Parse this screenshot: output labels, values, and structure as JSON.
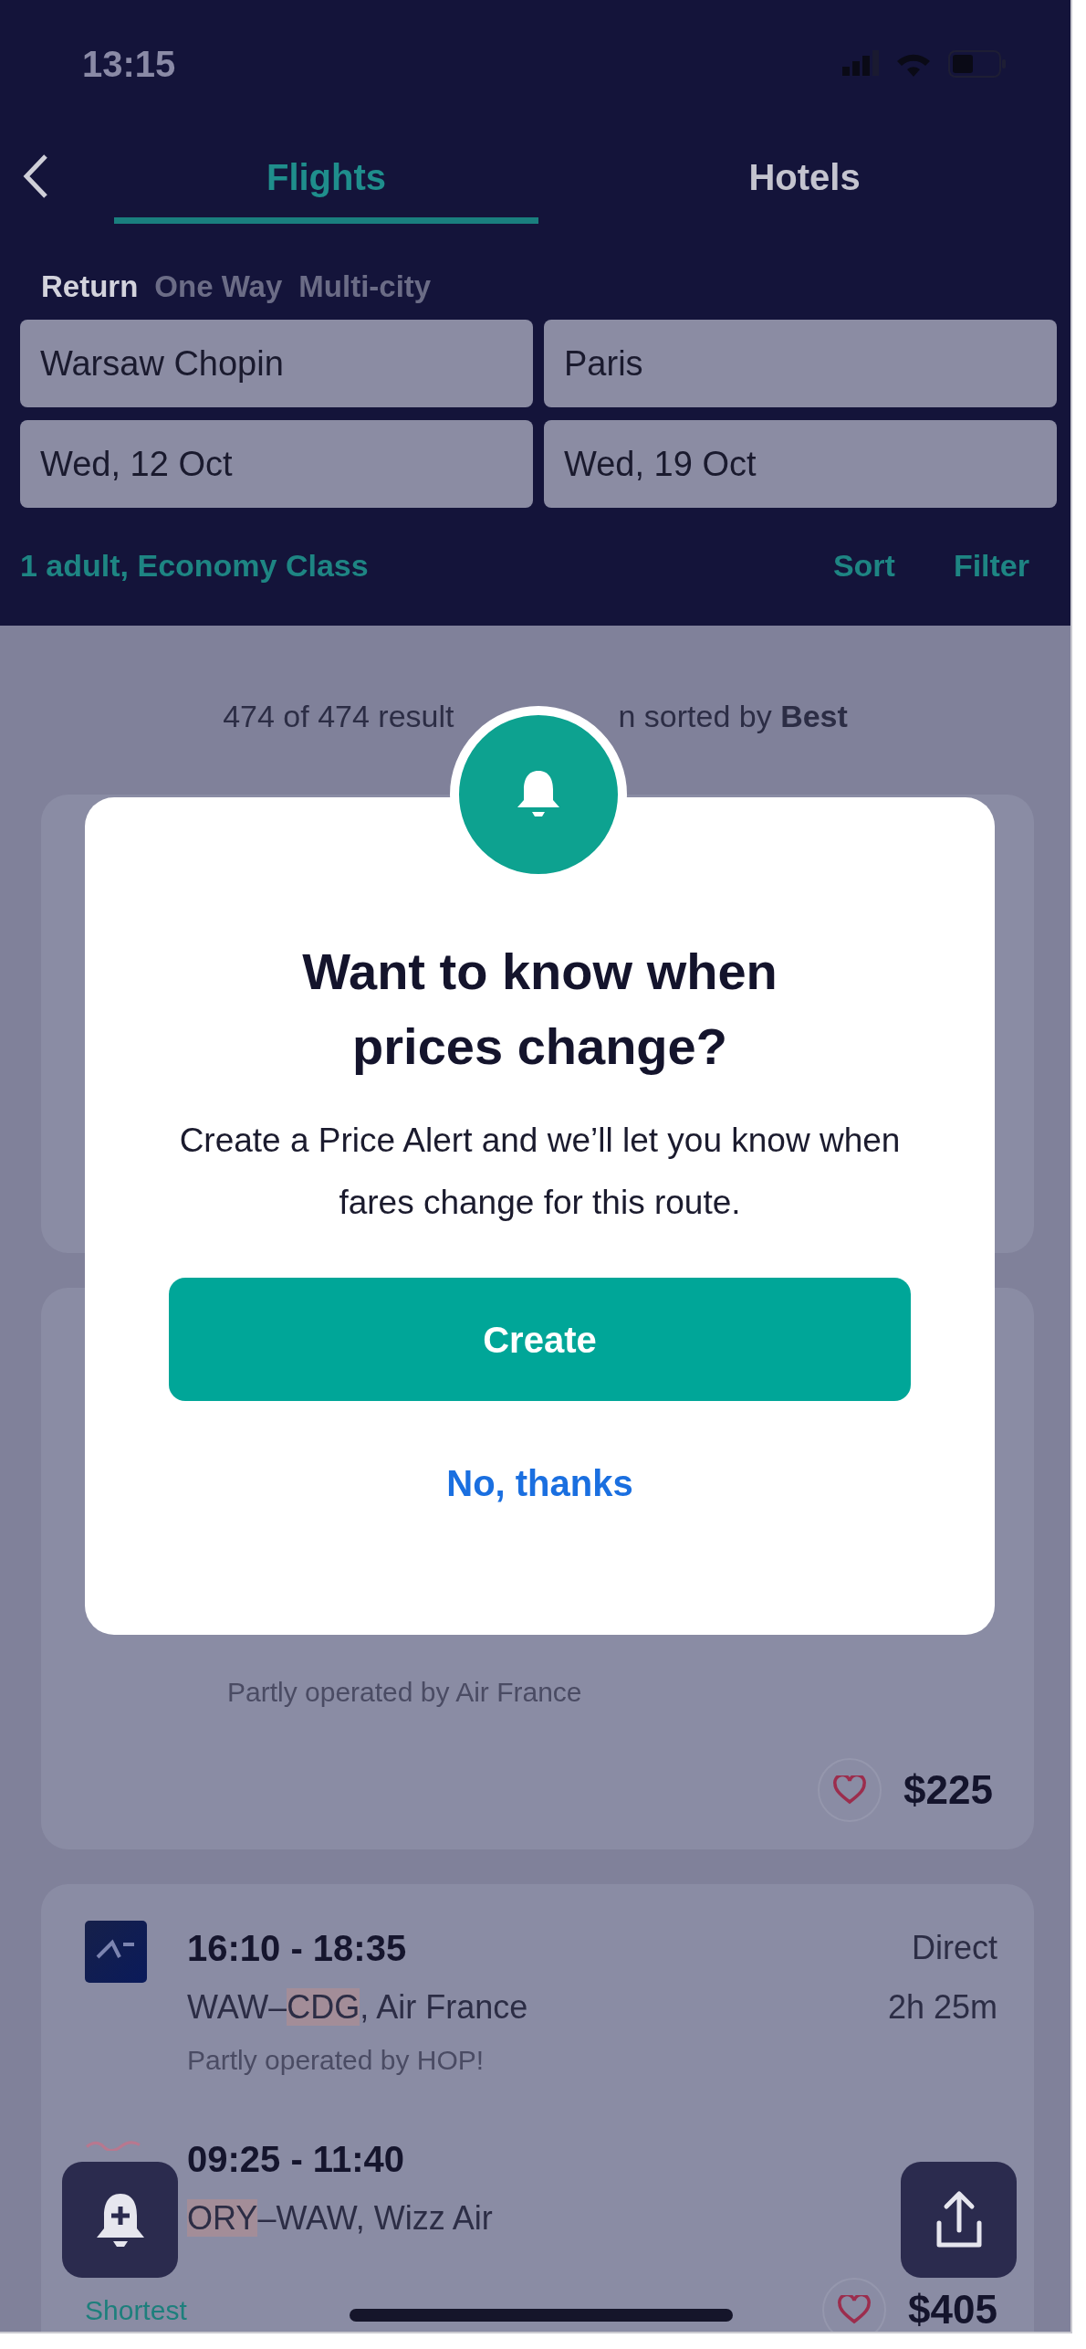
{
  "status_bar": {
    "time": "13:15"
  },
  "tabs": [
    {
      "label": "Flights",
      "selected": true
    },
    {
      "label": "Hotels",
      "selected": false
    }
  ],
  "trip_types": [
    {
      "label": "Return",
      "selected": true
    },
    {
      "label": "One Way",
      "selected": false
    },
    {
      "label": "Multi-city",
      "selected": false
    }
  ],
  "fields": [
    {
      "value": "Warsaw Chopin"
    },
    {
      "value": "Paris"
    },
    {
      "value": "Wed, 12 Oct"
    },
    {
      "value": "Wed, 19 Oct"
    }
  ],
  "passengers": "1 adult, Economy Class",
  "actions": [
    "Sort",
    "Filter"
  ],
  "results_summary": {
    "before": "474 of 474 result",
    "after": "n sorted by **Best**"
  },
  "results": [
    {
      "legs": [
        {
          "operated_by": "Partly operated by Air France"
        }
      ],
      "price": "$225",
      "saved": false
    },
    {
      "legs": [
        {
          "kind": "navy",
          "times": "16:10 - 18:35",
          "route": [
            {
              "text": "WAW–",
              "highlighted": false
            },
            {
              "text": "CDG",
              "highlighted": true
            },
            {
              "text": ", Air France",
              "highlighted": false
            }
          ],
          "stops": "Direct",
          "duration": "2h 25m",
          "operated_by": "Partly operated by HOP!"
        },
        {
          "kind": "pink",
          "times": "09:25 - 11:40",
          "route": [
            {
              "text": "ORY",
              "highlighted": true
            },
            {
              "text": "–WAW, Wizz Air",
              "highlighted": false
            }
          ]
        }
      ],
      "tag": "Shortest",
      "price": "$405",
      "saved": false
    }
  ],
  "modal": {
    "title": "Want to know when prices change?",
    "body": "Create a Price Alert and we’ll let you know when fares change for this route.",
    "primary": "Create",
    "secondary": "No, thanks"
  }
}
